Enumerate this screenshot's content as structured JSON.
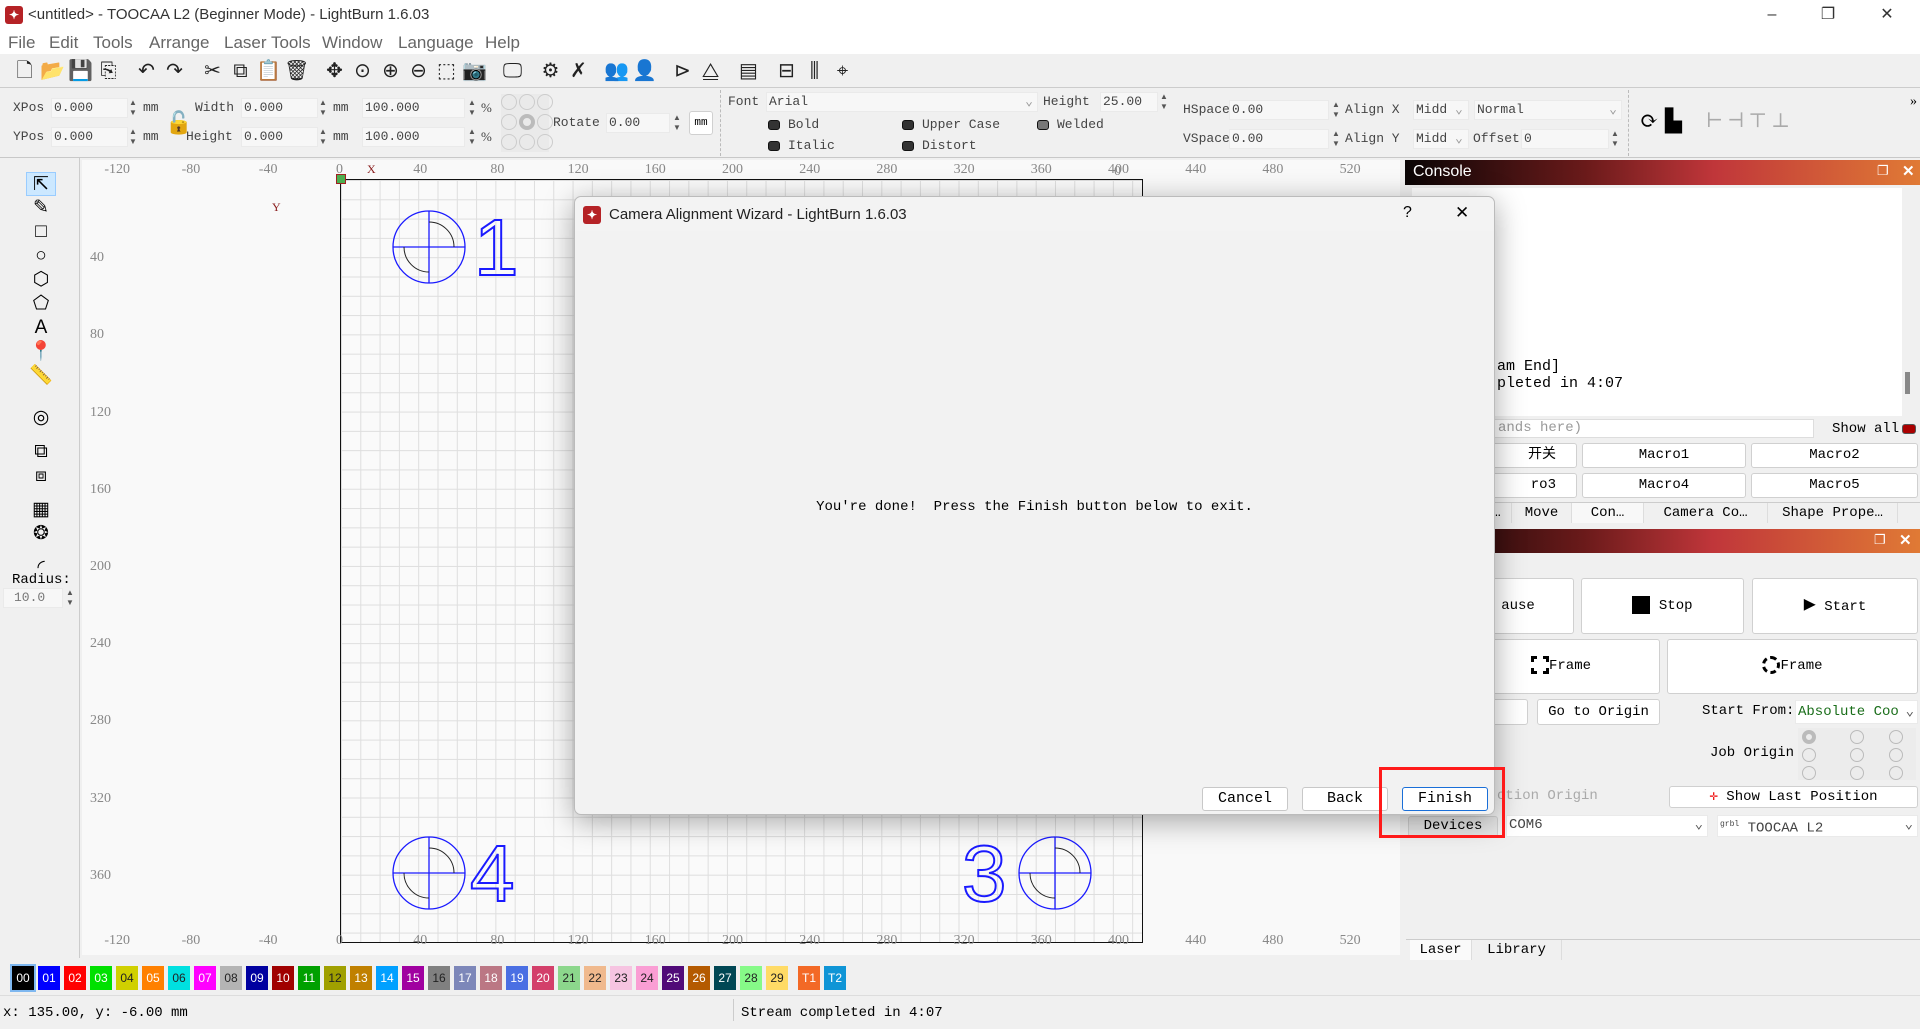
{
  "window": {
    "title": "<untitled> - TOOCAA L2 (Beginner Mode) - LightBurn 1.6.03",
    "minimize": "–",
    "maximize": "❐",
    "close": "✕"
  },
  "menu": [
    "File",
    "Edit",
    "Tools",
    "Arrange",
    "Laser Tools",
    "Window",
    "Language",
    "Help"
  ],
  "toolbar_icons": [
    "new-file-icon",
    "open-folder-icon",
    "save-icon",
    "import-icon",
    "undo-icon",
    "redo-icon",
    "cut-icon",
    "copy-icon",
    "paste-icon",
    "delete-icon",
    "move-icon",
    "zoom-page-icon",
    "zoom-in-icon",
    "zoom-out-icon",
    "zoom-selection-icon",
    "camera-icon",
    "monitor-icon",
    "settings-icon",
    "tools-icon",
    "group-icon",
    "user-icon",
    "mirror-h-icon",
    "mirror-v-icon",
    "align-icon",
    "distribute-icon",
    "distribute-v-icon",
    "snap-icon"
  ],
  "props": {
    "xpos_label": "XPos",
    "xpos": "0.000",
    "ypos_label": "YPos",
    "ypos": "0.000",
    "unit": "mm",
    "width_label": "Width",
    "width": "0.000",
    "height_label": "Height",
    "height": "0.000",
    "width_pct": "100.000",
    "height_pct": "100.000",
    "pct": "%",
    "rotate_label": "Rotate",
    "rotate": "0.00",
    "mm_button": "mm",
    "font_label": "Font",
    "font": "Arial",
    "text_height_label": "Height",
    "text_height": "25.00",
    "bold": "Bold",
    "italic": "Italic",
    "upper_case": "Upper Case",
    "distort": "Distort",
    "welded": "Welded",
    "hspace_label": "HSpace",
    "hspace": "0.00",
    "vspace_label": "VSpace",
    "vspace": "0.00",
    "align_x_label": "Align X",
    "align_x": "Midd",
    "align_y_label": "Align Y",
    "align_y": "Midd",
    "mode": "Normal",
    "offset_label": "Offset",
    "offset": "0",
    "more": "»"
  },
  "left_tools": [
    "select-icon",
    "pencil-icon",
    "rectangle-icon",
    "ellipse-icon",
    "polygon-icon",
    "polyline-icon",
    "text-icon",
    "position-marker-icon",
    "measure-icon",
    "offset-icon",
    "boolean-union-icon",
    "boolean-weld-icon",
    "grid-array-icon",
    "circular-array-icon",
    "corner-radius-icon"
  ],
  "radius": {
    "label": "Radius:",
    "value": "10.0"
  },
  "rulers": {
    "top": [
      "-120",
      "-80",
      "-40",
      "0",
      "40",
      "80",
      "120",
      "160",
      "200",
      "240",
      "280",
      "320",
      "360",
      "400",
      "440",
      "480",
      "520"
    ],
    "left": [
      "40",
      "80",
      "120",
      "160",
      "200",
      "240",
      "280",
      "320",
      "360"
    ],
    "right": [
      "0",
      "360",
      "400"
    ],
    "x_axis": "X",
    "y_axis": "Y"
  },
  "targets": [
    {
      "label": "1"
    },
    {
      "label": "4"
    },
    {
      "label": "3"
    }
  ],
  "console": {
    "title": "Console",
    "lines": [
      "am End]",
      "pleted in 4:07"
    ],
    "command_placeholder": "ands here)",
    "show_all": "Show all",
    "macros": [
      "开关",
      "Macro1",
      "Macro2",
      "ro3",
      "Macro4",
      "Macro5"
    ],
    "tabs": [
      "…",
      "Move",
      "Con…",
      "Camera Co…",
      "Shape Prope…"
    ]
  },
  "laser": {
    "pause": "ause",
    "stop": "Stop",
    "start": "Start",
    "frame1": "Frame",
    "frame2": "Frame",
    "go_origin": "Go to Origin",
    "start_from_label": "Start From:",
    "start_from": "Absolute Coo",
    "job_origin_label": "Job Origin",
    "user_origin": "ction Origin",
    "show_last": "Show Last Position",
    "devices": "Devices",
    "port": "COM6",
    "device": "TOOCAA L2",
    "device_badge": "grbl"
  },
  "bottom_tabs": [
    "Laser",
    "Library"
  ],
  "palette": [
    {
      "id": "00",
      "color": "#000000"
    },
    {
      "id": "01",
      "color": "#0000ff"
    },
    {
      "id": "02",
      "color": "#ff0000"
    },
    {
      "id": "03",
      "color": "#00e000"
    },
    {
      "id": "04",
      "color": "#d0d000"
    },
    {
      "id": "05",
      "color": "#ff8000"
    },
    {
      "id": "06",
      "color": "#00e0e0"
    },
    {
      "id": "07",
      "color": "#ff00ff"
    },
    {
      "id": "08",
      "color": "#b4b4b4"
    },
    {
      "id": "09",
      "color": "#0000a0"
    },
    {
      "id": "10",
      "color": "#a00000"
    },
    {
      "id": "11",
      "color": "#00a000"
    },
    {
      "id": "12",
      "color": "#a0a000"
    },
    {
      "id": "13",
      "color": "#c08000"
    },
    {
      "id": "14",
      "color": "#00a0ff"
    },
    {
      "id": "15",
      "color": "#a000a0"
    },
    {
      "id": "16",
      "color": "#808080"
    },
    {
      "id": "17",
      "color": "#7d87b9"
    },
    {
      "id": "18",
      "color": "#bb7784"
    },
    {
      "id": "19",
      "color": "#4a6fe3"
    },
    {
      "id": "20",
      "color": "#d33f6a"
    },
    {
      "id": "21",
      "color": "#8cd78c"
    },
    {
      "id": "22",
      "color": "#f0b98d"
    },
    {
      "id": "23",
      "color": "#f6c4e1"
    },
    {
      "id": "24",
      "color": "#fa9ed4"
    },
    {
      "id": "25",
      "color": "#500a78"
    },
    {
      "id": "26",
      "color": "#b45a00"
    },
    {
      "id": "27",
      "color": "#004754"
    },
    {
      "id": "28",
      "color": "#86fa88"
    },
    {
      "id": "29",
      "color": "#ffdb66"
    },
    {
      "id": "T1",
      "color": "#f36926"
    },
    {
      "id": "T2",
      "color": "#0f95d6"
    }
  ],
  "status": {
    "coords": "x: 135.00, y: -6.00 mm",
    "message": "Stream completed in 4:07"
  },
  "dialog": {
    "title": "Camera Alignment Wizard - LightBurn 1.6.03",
    "help": "?",
    "close": "✕",
    "message": "You're done!  Press the Finish button below to exit.",
    "cancel": "Cancel",
    "back": "Back",
    "finish": "Finish"
  },
  "colors": {
    "accent": "#b52226",
    "highlight": "#ff1a1a",
    "target": "#1a1aff"
  }
}
